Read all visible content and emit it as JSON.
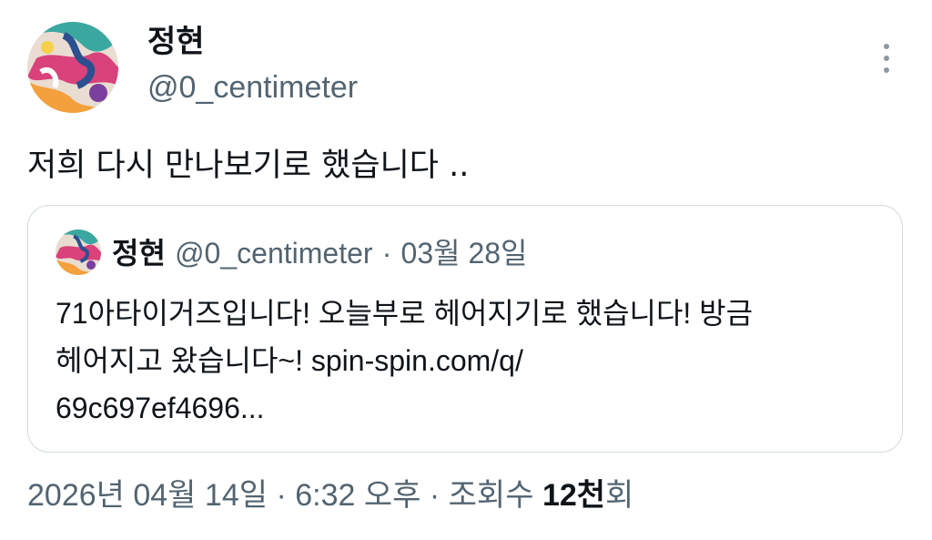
{
  "author": {
    "name": "정현",
    "handle": "@0_centimeter"
  },
  "tweet": {
    "text": "저희 다시 만나보기로 했습니다 .."
  },
  "quote": {
    "name": "정현",
    "handle": "@0_centimeter",
    "separator": "·",
    "date": "03월 28일",
    "lines": [
      "71아타이거즈입니다! 오늘부로 헤어지기로 했습니다! 방금",
      "헤어지고 왔습니다~! spin-spin.com/q/",
      "69c697ef4696..."
    ]
  },
  "meta": {
    "date": "2026년 04월 14일",
    "separator1": " · ",
    "time": "6:32 오후",
    "separator2": " · ",
    "views_label": "조회수 ",
    "views_count": "12천",
    "views_suffix": "회"
  },
  "icons": {
    "more": "more-vertical-icon"
  },
  "colors": {
    "text": "#0f1419",
    "secondary": "#536471",
    "border": "#cfd9de",
    "icon": "#8b98a5"
  }
}
